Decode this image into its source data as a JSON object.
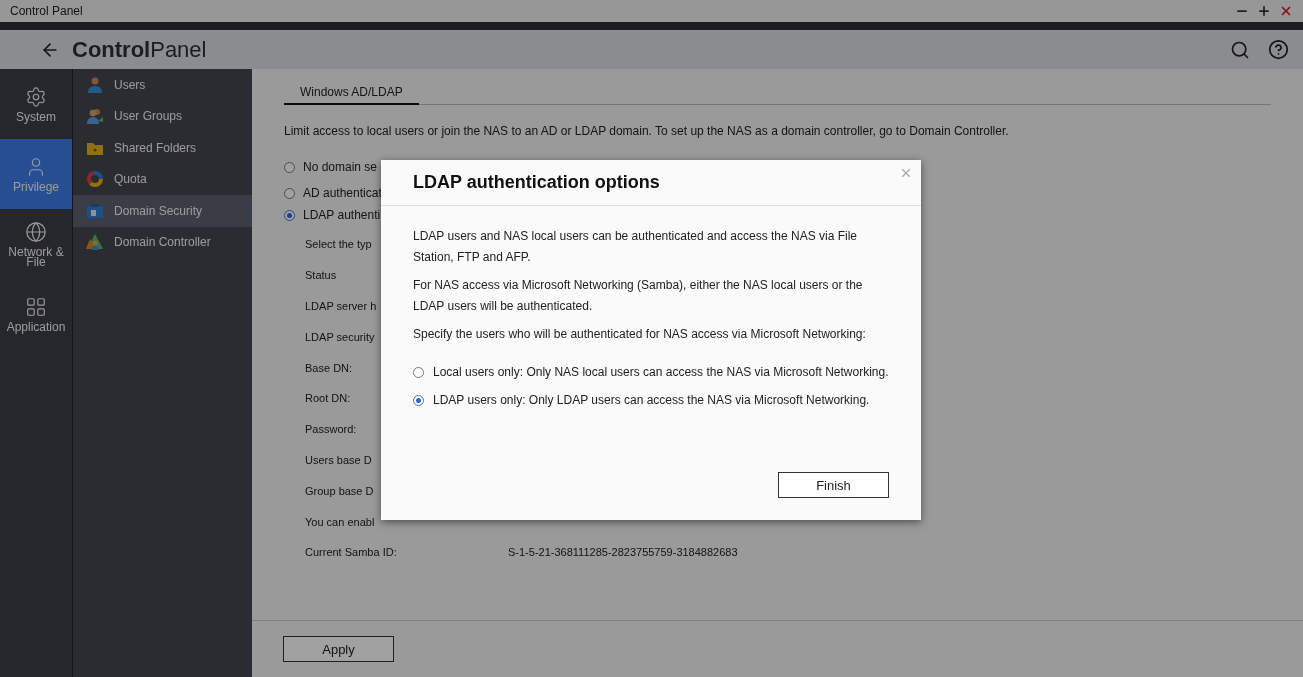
{
  "window": {
    "title": "Control Panel"
  },
  "header": {
    "title": "**Control**Panel"
  },
  "nav": [
    {
      "label": "System",
      "selected": false
    },
    {
      "label": "Privilege",
      "selected": true
    },
    {
      "label": "Network & File",
      "selected": false
    },
    {
      "label": "Application",
      "selected": false
    }
  ],
  "submenu": [
    {
      "label": "Users",
      "selected": false
    },
    {
      "label": "User Groups",
      "selected": false
    },
    {
      "label": "Shared Folders",
      "selected": false
    },
    {
      "label": "Quota",
      "selected": false
    },
    {
      "label": "Domain Security",
      "selected": true
    },
    {
      "label": "Domain Controller",
      "selected": false
    }
  ],
  "tabs": [
    {
      "label": "Windows AD/LDAP",
      "selected": true
    }
  ],
  "intro": "Limit access to local users or join the NAS to an AD or LDAP domain. To set up the NAS as a domain controller, go to Domain Controller.",
  "security_options": [
    {
      "label": "No domain se",
      "selected": false
    },
    {
      "label": "AD authenticat",
      "selected": false
    },
    {
      "label": "LDAP authenti",
      "selected": true
    }
  ],
  "fields": [
    {
      "label": "Select the typ"
    },
    {
      "label": "Status"
    },
    {
      "label": "LDAP server h"
    },
    {
      "label": "LDAP security"
    },
    {
      "label": "Base DN:"
    },
    {
      "label": "Root DN:"
    },
    {
      "label": "Password:"
    },
    {
      "label": "Users base D"
    },
    {
      "label": "Group base D"
    },
    {
      "label": "You can enabl"
    },
    {
      "label": "Current Samba ID:",
      "value": "S-1-5-21-368111285-2823755759-3184882683"
    }
  ],
  "apply_button": "Apply",
  "dialog": {
    "title": "LDAP authentication options",
    "paragraphs": [
      "LDAP users and NAS local users can be authenticated and access the NAS via File Station, FTP and AFP.",
      "For NAS access via Microsoft Networking (Samba), either the NAS local users or the LDAP users will be authenticated.",
      "Specify the users who will be authenticated for NAS access via Microsoft Networking:"
    ],
    "options": [
      {
        "label": "Local users only: Only NAS local users can access the NAS via Microsoft Networking.",
        "selected": false
      },
      {
        "label": "LDAP users only: Only LDAP users can access the NAS via Microsoft Networking.",
        "selected": true
      }
    ],
    "button": "Finish"
  }
}
